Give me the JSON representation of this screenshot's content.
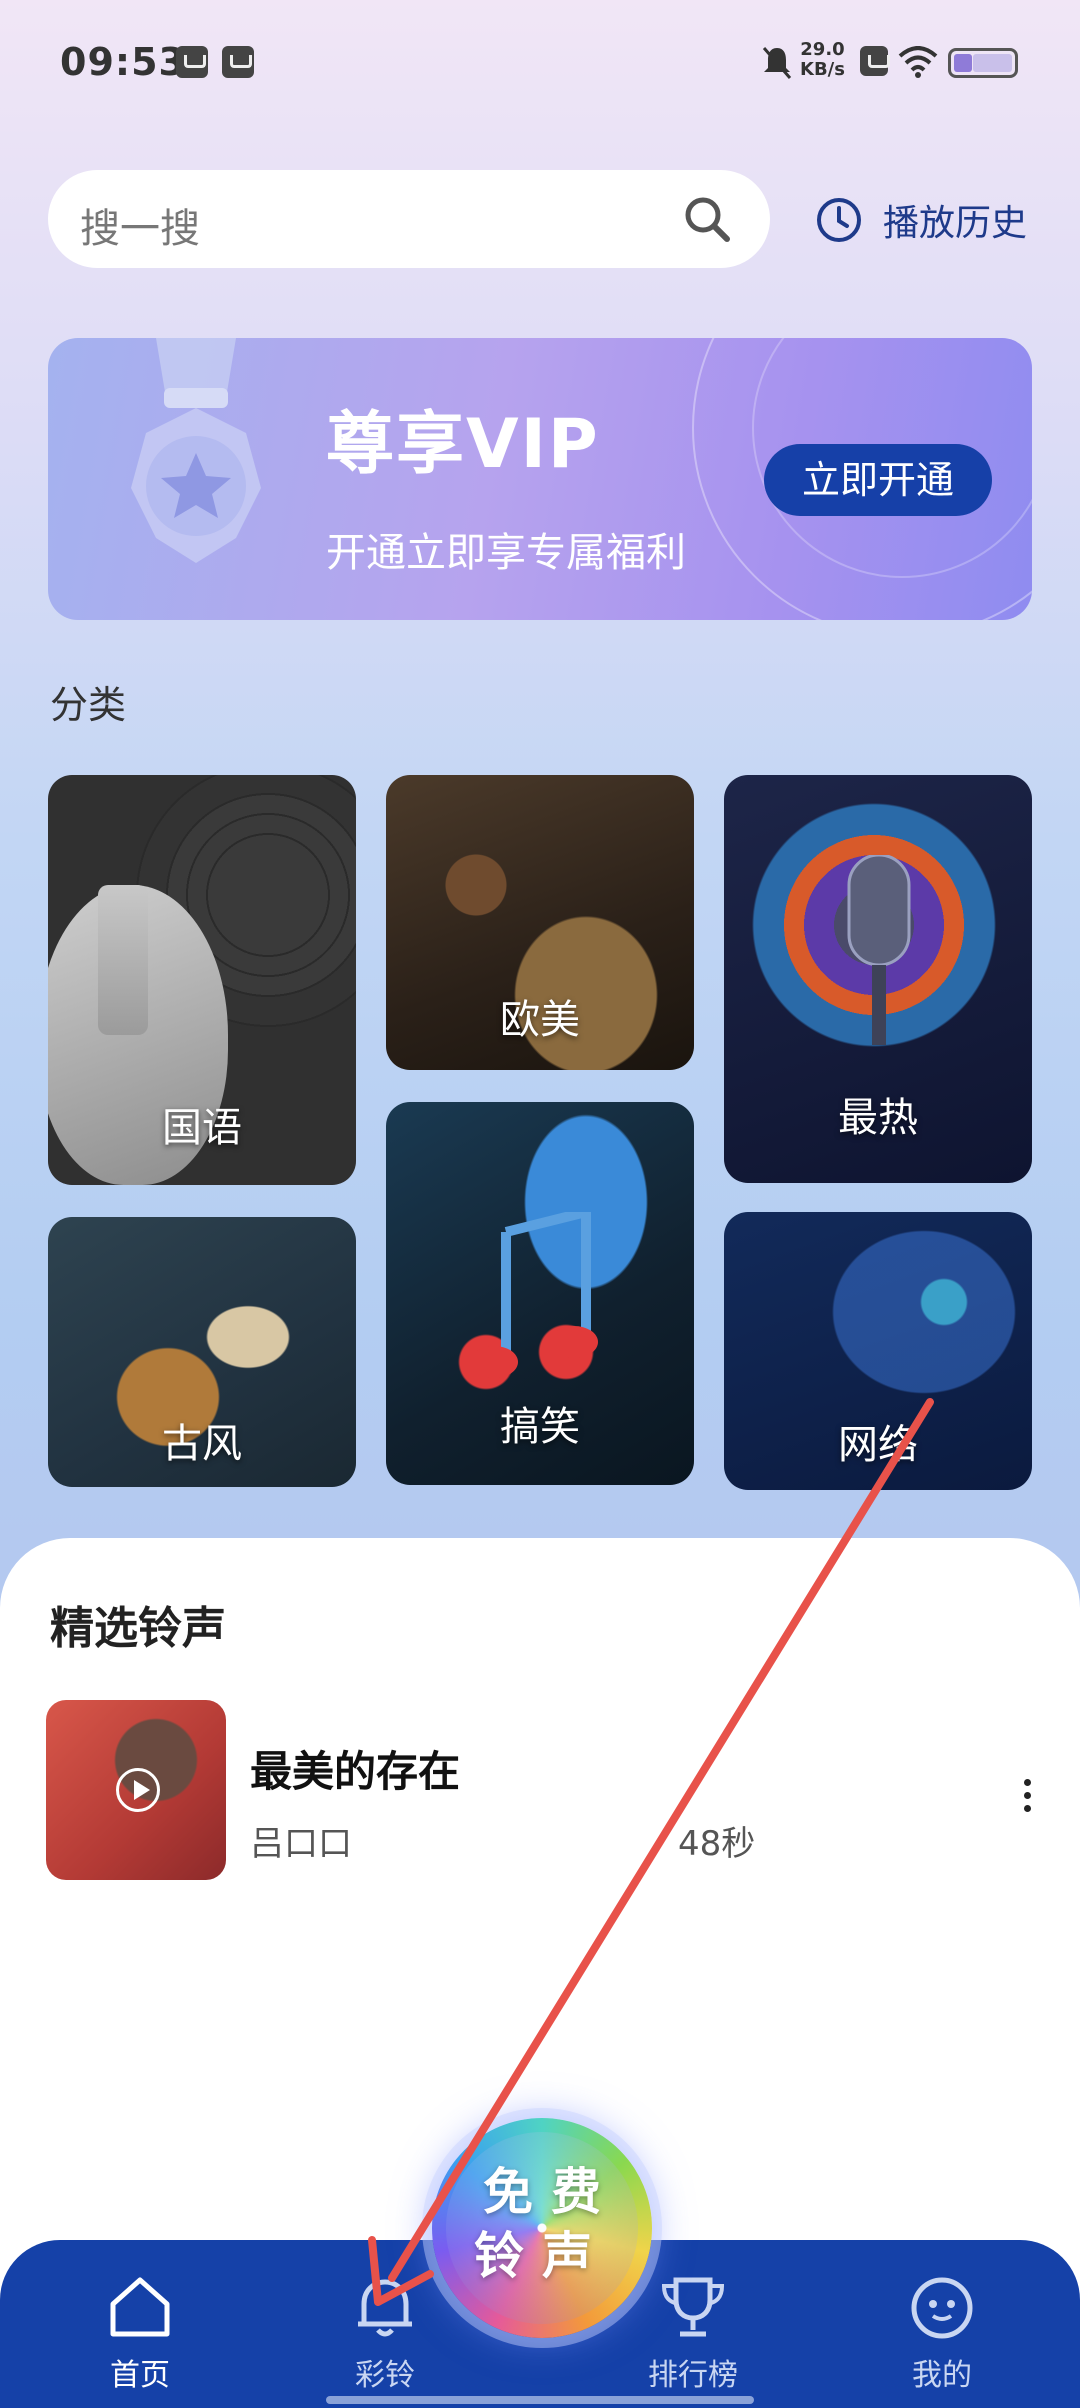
{
  "status_bar": {
    "time": "09:53",
    "net_speed_value": "29.0",
    "net_speed_unit": "KB/s"
  },
  "search": {
    "placeholder": "搜一搜",
    "history_label": "播放历史"
  },
  "vip_banner": {
    "title": "尊享VIP",
    "subtitle": "开通立即享专属福利",
    "button": "立即开通"
  },
  "categories_section": {
    "label": "分类",
    "items": [
      {
        "label": "国语"
      },
      {
        "label": "欧美"
      },
      {
        "label": "最热"
      },
      {
        "label": "古风"
      },
      {
        "label": "搞笑"
      },
      {
        "label": "网络"
      }
    ]
  },
  "featured": {
    "title": "精选铃声",
    "songs": [
      {
        "title": "最美的存在",
        "artist": "吕口口",
        "duration": "48秒"
      }
    ]
  },
  "fab": {
    "text": "免费铃声"
  },
  "bottom_nav": {
    "items": [
      {
        "label": "首页",
        "icon": "home-icon",
        "active": true
      },
      {
        "label": "彩铃",
        "icon": "bell-icon",
        "active": false
      },
      {
        "label": "排行榜",
        "icon": "trophy-icon",
        "active": false
      },
      {
        "label": "我的",
        "icon": "profile-icon",
        "active": false
      }
    ]
  },
  "colors": {
    "nav_bar": "#1541a8",
    "vip_button": "#1640a8",
    "annotation_arrow": "#e8524a"
  }
}
